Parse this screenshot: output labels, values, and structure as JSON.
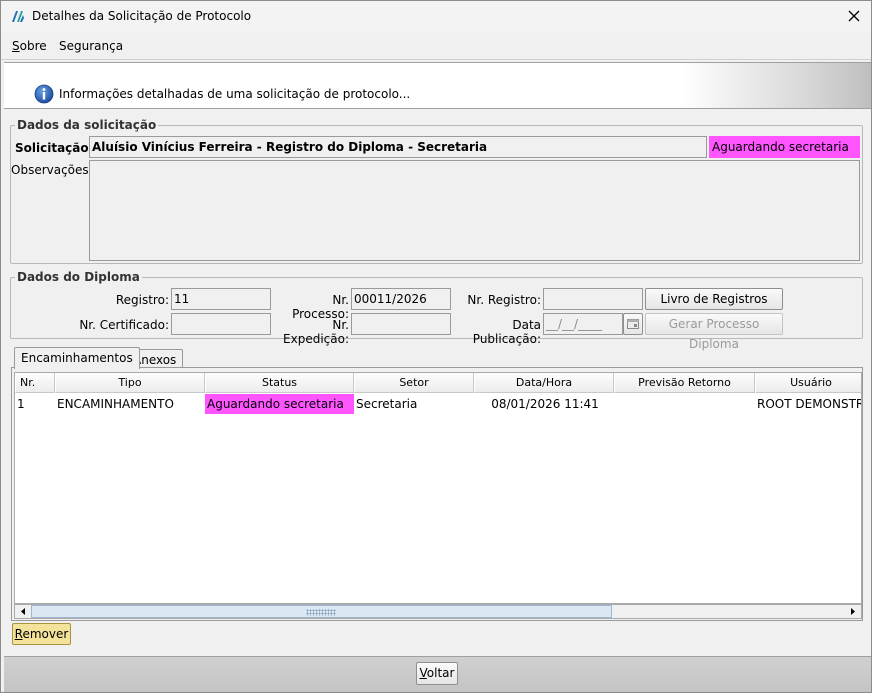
{
  "window": {
    "title": "Detalhes da Solicitação de Protocolo"
  },
  "menu": {
    "sobre_first": "S",
    "sobre_rest": "obre",
    "seguranca": "Segurança"
  },
  "banner": {
    "text": "Informações detalhadas de uma solicitação de protocolo..."
  },
  "solicitacao_group": {
    "title": "Dados da solicitação",
    "solicitacao_label": "Solicitação:",
    "solicitacao_value": "Aluísio Vinícius Ferreira - Registro do Diploma - Secretaria",
    "status_value": "Aguardando secretaria",
    "observacoes_label": "Observações:",
    "observacoes_value": ""
  },
  "diploma_group": {
    "title": "Dados do Diploma",
    "registro_label": "Registro:",
    "registro_value": "11",
    "nr_processo_label": "Nr. Processo:",
    "nr_processo_value": "00011/2026",
    "nr_registro_label": "Nr. Registro:",
    "nr_registro_value": "",
    "livro_button": "Livro de Registros",
    "nr_certificado_label": "Nr. Certificado:",
    "nr_certificado_value": "",
    "nr_expedicao_label": "Nr. Expedição:",
    "nr_expedicao_value": "",
    "data_publicacao_label": "Data Publicação:",
    "data_publicacao_value": "__/__/____",
    "gerar_button": "Gerar Processo Diploma"
  },
  "tabs": [
    {
      "label": "Encaminhamentos"
    },
    {
      "label": "Anexos"
    }
  ],
  "table": {
    "columns": [
      "Nr.",
      "Tipo",
      "Status",
      "Setor",
      "Data/Hora",
      "Previsão Retorno",
      "Usuário"
    ],
    "rows": [
      {
        "nr": "1",
        "tipo": "ENCAMINHAMENTO",
        "status": "Aguardando secretaria",
        "setor": "Secretaria",
        "data_hora": "08/01/2026 11:41",
        "previsao": "",
        "usuario": "ROOT DEMONSTRAC"
      }
    ]
  },
  "remover_first": "R",
  "remover_rest": "emover",
  "voltar_first": "V",
  "voltar_rest": "oltar",
  "colors": {
    "status_highlight": "#ff55ff",
    "remover_bg": "#f3e39a",
    "accent": "#1f5fb0"
  },
  "icons": {
    "app": "app-logo-icon",
    "close": "close-icon",
    "info": "info-icon",
    "calendar": "calendar-icon",
    "scroll_left": "arrow-left-icon",
    "scroll_right": "arrow-right-icon"
  }
}
